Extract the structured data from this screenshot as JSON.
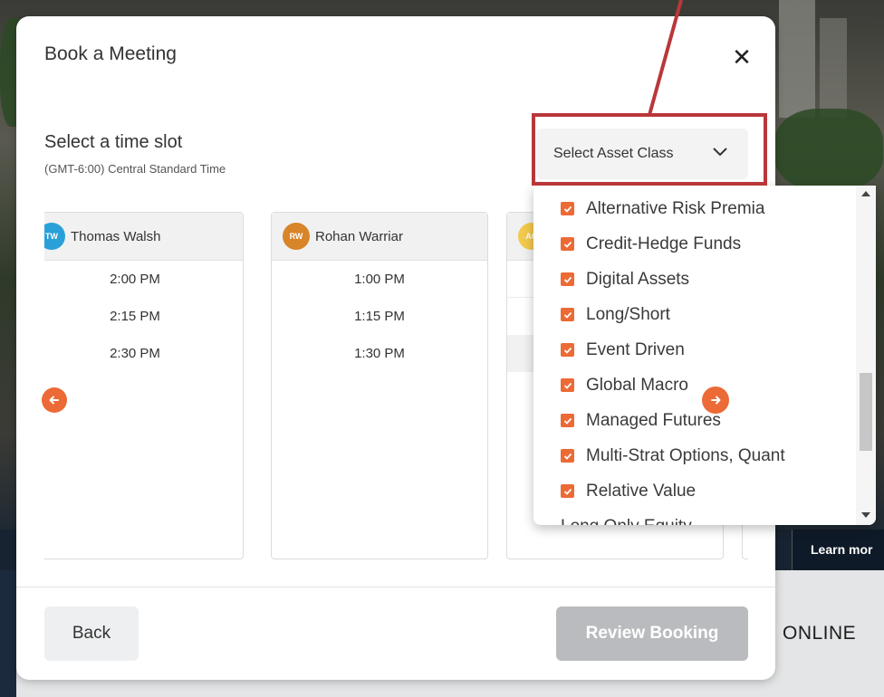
{
  "modal": {
    "title": "Book a Meeting",
    "close_glyph": "✕",
    "slot_title": "Select a time slot",
    "timezone": "(GMT-6:00) Central Standard Time",
    "asset_select_label": "Select Asset Class",
    "back_label": "Back",
    "review_label": "Review Booking"
  },
  "advisors": [
    {
      "initials": "TW",
      "name": "Thomas Walsh",
      "color": "#2aa0d8",
      "slots": [
        "2:00 PM",
        "2:15 PM",
        "2:30 PM"
      ]
    },
    {
      "initials": "RW",
      "name": "Rohan Warriar",
      "color": "#d8852a",
      "slots": [
        "1:00 PM",
        "1:15 PM",
        "1:30 PM"
      ]
    },
    {
      "initials": "AG",
      "name": "",
      "color": "#f2c94c",
      "slots": []
    }
  ],
  "asset_classes": [
    {
      "label": "Alternative Risk Premia",
      "checked": true
    },
    {
      "label": "Credit-Hedge Funds",
      "checked": true
    },
    {
      "label": "Digital Assets",
      "checked": true
    },
    {
      "label": "Long/Short",
      "checked": true
    },
    {
      "label": "Event Driven",
      "checked": true
    },
    {
      "label": "Global Macro",
      "checked": true
    },
    {
      "label": "Managed Futures",
      "checked": true
    },
    {
      "label": "Multi-Strat Options, Quant",
      "checked": true
    },
    {
      "label": "Relative Value",
      "checked": true
    },
    {
      "label": "Long Only Equity",
      "checked": false
    }
  ],
  "background": {
    "learn_more": "Learn mor",
    "online": "ONLINE"
  },
  "colors": {
    "accent": "#ec6a35",
    "annotation": "#b9373a",
    "disabled_button": "#b9bbbe"
  }
}
